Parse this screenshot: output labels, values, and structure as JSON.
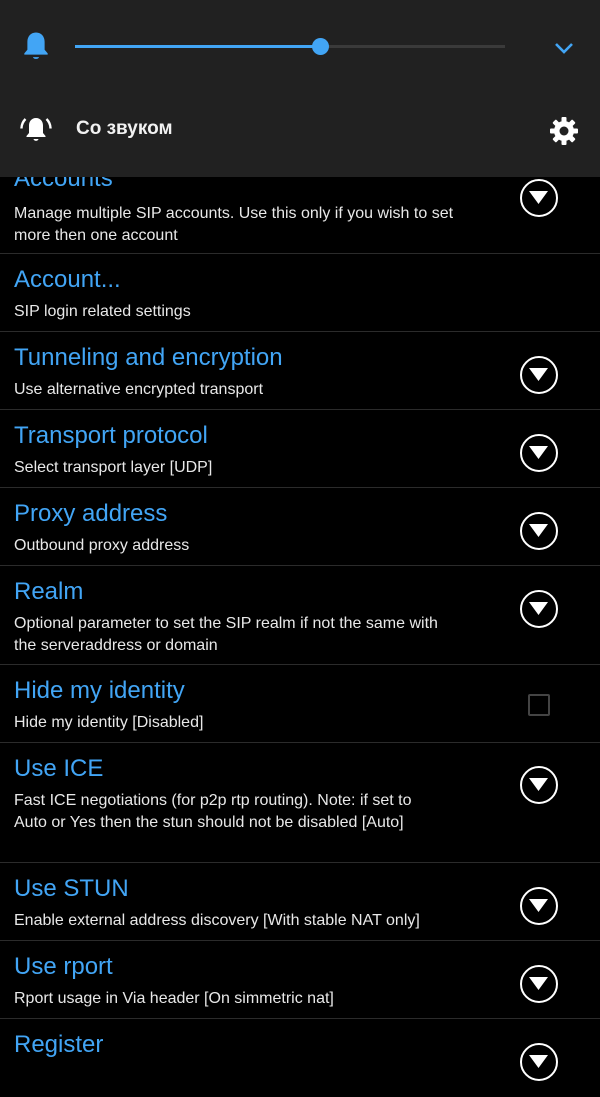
{
  "volume_panel": {
    "slider_value": 0.57,
    "accent_color": "#42a5f5",
    "mode_label": "Со звуком",
    "icons": [
      "bell-icon",
      "chevron-down-icon",
      "ringer-icon",
      "gear-icon"
    ]
  },
  "list": {
    "title_color": "#42a5f5",
    "items": [
      {
        "title": "Accounts",
        "summary": "Manage multiple SIP accounts. Use this only if you wish to set more then one account",
        "control": "dropdown"
      },
      {
        "title": "Account...",
        "summary": "SIP login related settings",
        "control": "none"
      },
      {
        "title": "Tunneling and encryption",
        "summary": "Use alternative encrypted transport",
        "control": "dropdown"
      },
      {
        "title": "Transport protocol",
        "summary": "Select transport layer [UDP]",
        "control": "dropdown"
      },
      {
        "title": "Proxy address",
        "summary": "Outbound proxy address",
        "control": "dropdown"
      },
      {
        "title": "Realm",
        "summary": "Optional parameter to set the SIP realm if not the same with the serveraddress or domain",
        "control": "dropdown"
      },
      {
        "title": "Hide my identity",
        "summary": "Hide my identity [Disabled]",
        "control": "checkbox",
        "checked": false
      },
      {
        "title": "Use ICE",
        "summary": "Fast ICE negotiations (for p2p rtp routing). Note: if set to Auto or Yes then the stun should not be disabled [Auto]",
        "control": "dropdown"
      },
      {
        "title": "Use STUN",
        "summary": "Enable external address discovery [With stable NAT only]",
        "control": "dropdown"
      },
      {
        "title": "Use rport",
        "summary": "Rport usage in Via header [On simmetric nat]",
        "control": "dropdown"
      },
      {
        "title": "Register",
        "summary": "",
        "control": "dropdown"
      }
    ]
  }
}
